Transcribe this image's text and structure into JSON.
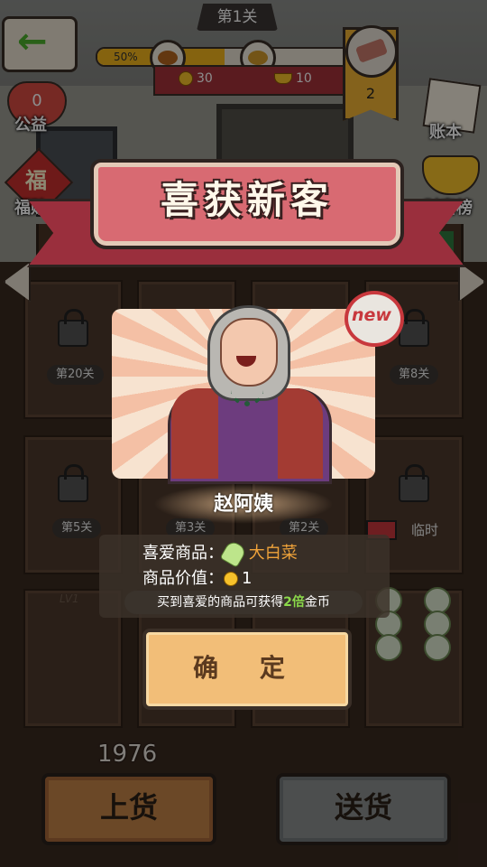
{
  "top": {
    "level_title": "第1关",
    "progress_label": "50%",
    "progress_fraction": 0.5,
    "reward_coins": "30",
    "reward_ingots": "10",
    "badge_count": "2"
  },
  "side": {
    "charity_count": "0",
    "charity_label": "公益",
    "ledger_label": "账本",
    "fortune_char": "福",
    "fortune_label": "福贴",
    "wealth_label": "财富榜"
  },
  "shelf_stands": [
    "150",
    "50"
  ],
  "shelves": {
    "locked_row1": [
      "第20关",
      "第8关"
    ],
    "locked_row2": [
      "第5关",
      "第3关",
      "第2关"
    ],
    "temp_label": "临时",
    "lvl_label": "LV1"
  },
  "popup": {
    "banner_title": "喜获新客",
    "new_badge": "new",
    "customer_name": "赵阿姨",
    "favorite_label": "喜爱商品：",
    "favorite_item": "大白菜",
    "value_label": "商品价值：",
    "value_amount": "1",
    "hint_prefix": "买到喜爱的商品可获得",
    "hint_multiplier": "2倍",
    "hint_suffix": "金币",
    "confirm_label": "确 定"
  },
  "bottom": {
    "money": "1976",
    "stock_label": "上货",
    "deliver_label": "送货"
  }
}
